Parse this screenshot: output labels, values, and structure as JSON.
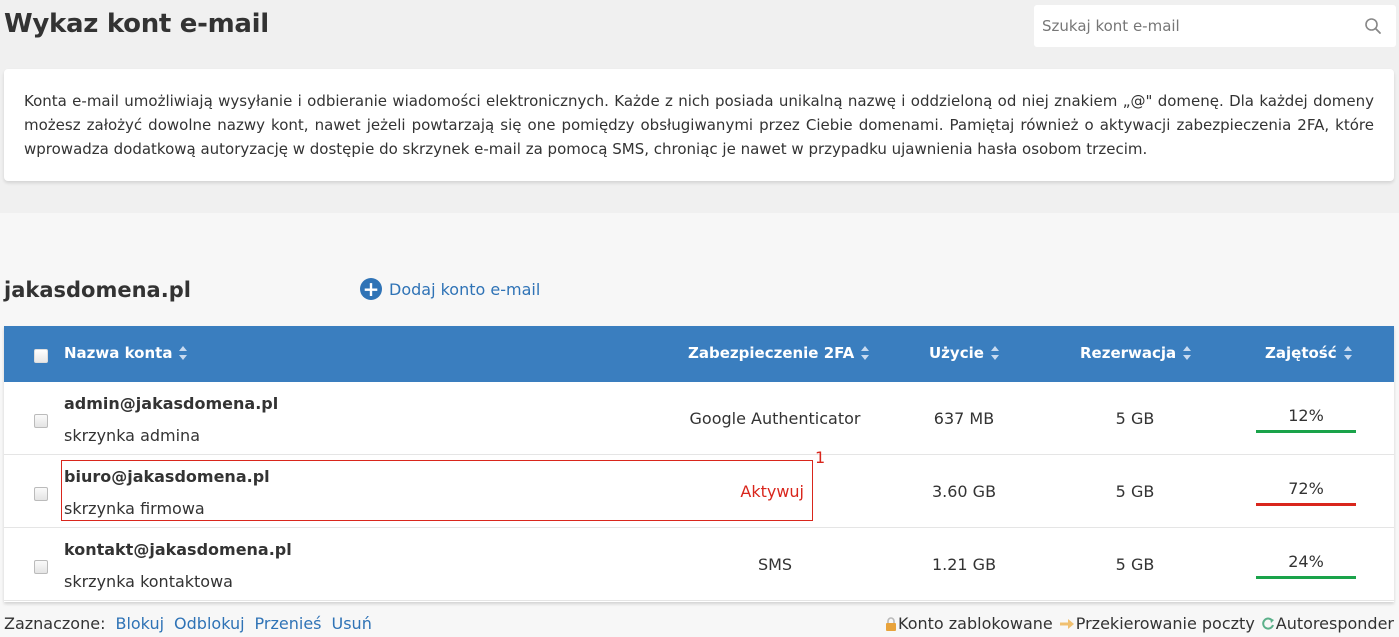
{
  "header": {
    "title": "Wykaz kont e-mail",
    "search_placeholder": "Szukaj kont e-mail"
  },
  "info": {
    "text": "Konta e-mail umożliwiają wysyłanie i odbieranie wiadomości elektronicznych. Każde z nich posiada unikalną nazwę i oddzieloną od niej znakiem „@\" domenę. Dla każdej domeny możesz założyć dowolne nazwy kont, nawet jeżeli powtarzają się one pomiędzy obsługiwanymi przez Ciebie domenami. Pamiętaj również o aktywacji zabezpieczenia 2FA, które wprowadza dodatkową autoryzację w dostępie do skrzynek e-mail za pomocą SMS, chroniąc je nawet w przypadku ujawnienia hasła osobom trzecim."
  },
  "domain": {
    "name": "jakasdomena.pl",
    "add_label": "Dodaj konto e-mail"
  },
  "table": {
    "columns": {
      "name": "Nazwa konta",
      "twofa": "Zabezpieczenie 2FA",
      "usage": "Użycie",
      "reservation": "Rezerwacja",
      "occupancy": "Zajętość"
    },
    "rows": [
      {
        "email": "admin@jakasdomena.pl",
        "description": "skrzynka admina",
        "twofa": "Google Authenticator",
        "usage": "637 MB",
        "reservation": "5 GB",
        "occupancy": "12%",
        "occupancy_color": "#1aa34a"
      },
      {
        "email": "biuro@jakasdomena.pl",
        "description": "skrzynka firmowa",
        "twofa": "Aktywuj",
        "usage": "3.60 GB",
        "reservation": "5 GB",
        "occupancy": "72%",
        "occupancy_color": "#d9261c"
      },
      {
        "email": "kontakt@jakasdomena.pl",
        "description": "skrzynka kontaktowa",
        "twofa": "SMS",
        "usage": "1.21 GB",
        "reservation": "5 GB",
        "occupancy": "24%",
        "occupancy_color": "#1aa34a"
      }
    ]
  },
  "annotation": {
    "number": "1"
  },
  "footer": {
    "selected_label": "Zaznaczone:",
    "actions": [
      "Blokuj",
      "Odblokuj",
      "Przenieś",
      "Usuń"
    ],
    "legend": [
      "Konto zablokowane",
      "Przekierowanie poczty",
      "Autoresponder"
    ]
  },
  "colors": {
    "accent": "#3a7ebf",
    "link": "#2f73b6",
    "danger": "#d9261c",
    "ok": "#1aa34a"
  }
}
